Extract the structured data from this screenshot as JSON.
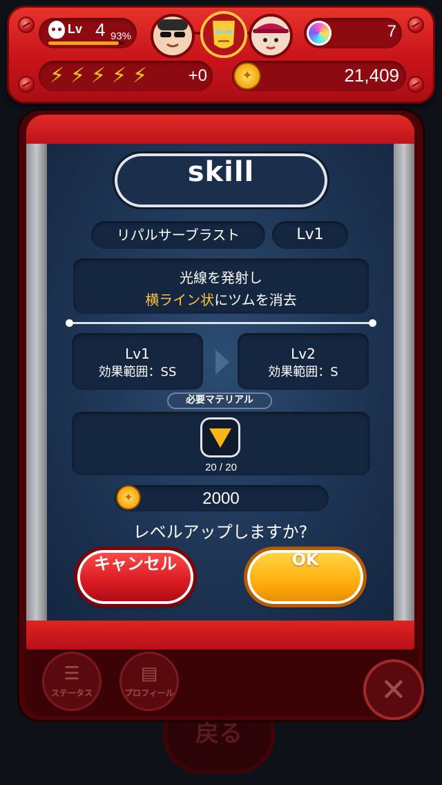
{
  "hud": {
    "level_label": "Lv",
    "level": "4",
    "level_progress": "93%",
    "level_progress_fraction": 0.93,
    "gems": "7",
    "hearts_bonus": "+0",
    "coins": "21,409",
    "colors": {
      "bar_red": "#c8141a",
      "bolt": "#ffc21c"
    }
  },
  "dialog": {
    "title": "skill",
    "skill_name": "リパルサーブラスト",
    "skill_level": "Lv1",
    "description": {
      "line1": "光線を発射し",
      "line2_highlight": "横ライン状",
      "line2_rest": "にツムを消去"
    },
    "current": {
      "level": "Lv1",
      "effect": "効果範囲：SS"
    },
    "next": {
      "level": "Lv2",
      "effect": "効果範囲：S"
    },
    "material_label": "必要マテリアル",
    "material_count": "20 / 20",
    "cost": "2000",
    "question": "レベルアップしますか?",
    "cancel_label": "キャンセル",
    "ok_label": "OK",
    "colors": {
      "highlight": "#ffc23a",
      "ok": "#ffae0d",
      "cancel": "#d81a22"
    }
  },
  "footer": {
    "status_label": "ステータス",
    "profile_label": "プロフィール",
    "back_label": "戻る"
  }
}
